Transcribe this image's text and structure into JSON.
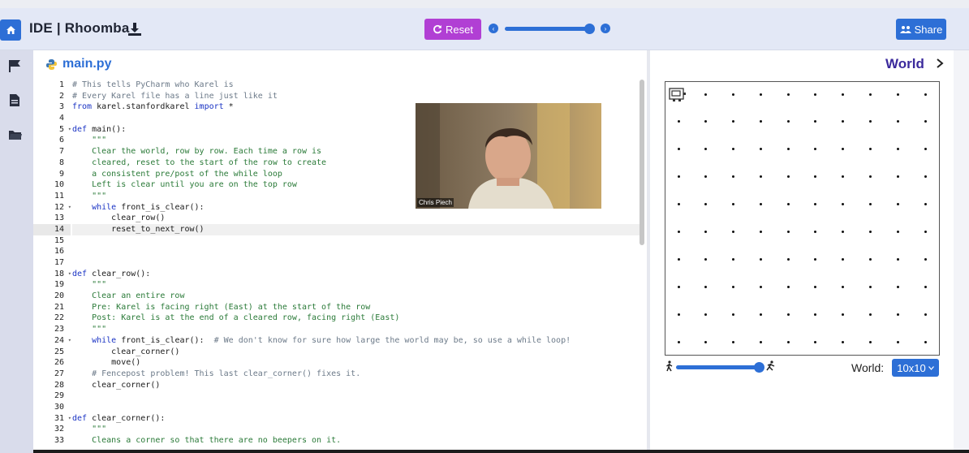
{
  "header": {
    "title": "IDE | Rhoomba",
    "reset_label": "Reset",
    "share_label": "Share",
    "speed_level": 0.9
  },
  "sidebar": {
    "icons": [
      "flag-icon",
      "file-icon",
      "folder-icon"
    ]
  },
  "editor": {
    "file_name": "main.py",
    "active_line": 14,
    "lines": [
      {
        "n": "1",
        "text": "# This tells PyCharm who Karel is",
        "kind": "comment"
      },
      {
        "n": "2",
        "text": "# Every Karel file has a line just like it",
        "kind": "comment"
      },
      {
        "n": "3",
        "text": "from karel.stanfordkarel import *",
        "kind": "import"
      },
      {
        "n": "4",
        "text": "",
        "kind": "plain"
      },
      {
        "n": "5",
        "text": "def main():",
        "kind": "def",
        "fold": true
      },
      {
        "n": "6",
        "text": "    \"\"\"",
        "kind": "string"
      },
      {
        "n": "7",
        "text": "    Clear the world, row by row. Each time a row is",
        "kind": "string"
      },
      {
        "n": "8",
        "text": "    cleared, reset to the start of the row to create",
        "kind": "string"
      },
      {
        "n": "9",
        "text": "    a consistent pre/post of the while loop",
        "kind": "string"
      },
      {
        "n": "10",
        "text": "    Left is clear until you are on the top row",
        "kind": "string"
      },
      {
        "n": "11",
        "text": "    \"\"\"",
        "kind": "string"
      },
      {
        "n": "12",
        "text": "    while front_is_clear():",
        "kind": "while",
        "fold": true
      },
      {
        "n": "13",
        "text": "        clear_row()",
        "kind": "plain"
      },
      {
        "n": "14",
        "text": "        reset_to_next_row()",
        "kind": "plain"
      },
      {
        "n": "15",
        "text": "",
        "kind": "plain"
      },
      {
        "n": "16",
        "text": "",
        "kind": "plain"
      },
      {
        "n": "17",
        "text": "",
        "kind": "plain"
      },
      {
        "n": "18",
        "text": "def clear_row():",
        "kind": "def",
        "fold": true
      },
      {
        "n": "19",
        "text": "    \"\"\"",
        "kind": "string"
      },
      {
        "n": "20",
        "text": "    Clear an entire row",
        "kind": "string"
      },
      {
        "n": "21",
        "text": "    Pre: Karel is facing right (East) at the start of the row",
        "kind": "string"
      },
      {
        "n": "22",
        "text": "    Post: Karel is at the end of a cleared row, facing right (East)",
        "kind": "string"
      },
      {
        "n": "23",
        "text": "    \"\"\"",
        "kind": "string"
      },
      {
        "n": "24",
        "text": "    while front_is_clear():  # We don't know for sure how large the world may be, so use a while loop!",
        "kind": "while_comment",
        "fold": true
      },
      {
        "n": "25",
        "text": "        clear_corner()",
        "kind": "plain"
      },
      {
        "n": "26",
        "text": "        move()",
        "kind": "plain"
      },
      {
        "n": "27",
        "text": "    # Fencepost problem! This last clear_corner() fixes it.",
        "kind": "comment"
      },
      {
        "n": "28",
        "text": "    clear_corner()",
        "kind": "plain"
      },
      {
        "n": "29",
        "text": "",
        "kind": "plain"
      },
      {
        "n": "30",
        "text": "",
        "kind": "plain"
      },
      {
        "n": "31",
        "text": "def clear_corner():",
        "kind": "def",
        "fold": true
      },
      {
        "n": "32",
        "text": "    \"\"\"",
        "kind": "string"
      },
      {
        "n": "33",
        "text": "    Cleans a corner so that there are no beepers on it.",
        "kind": "string"
      }
    ]
  },
  "webcam": {
    "name": "Chris Piech"
  },
  "world": {
    "title": "World",
    "size_label": "World:",
    "size_value": "10x10",
    "rows": 10,
    "cols": 10,
    "run_speed_level": 0.95
  }
}
